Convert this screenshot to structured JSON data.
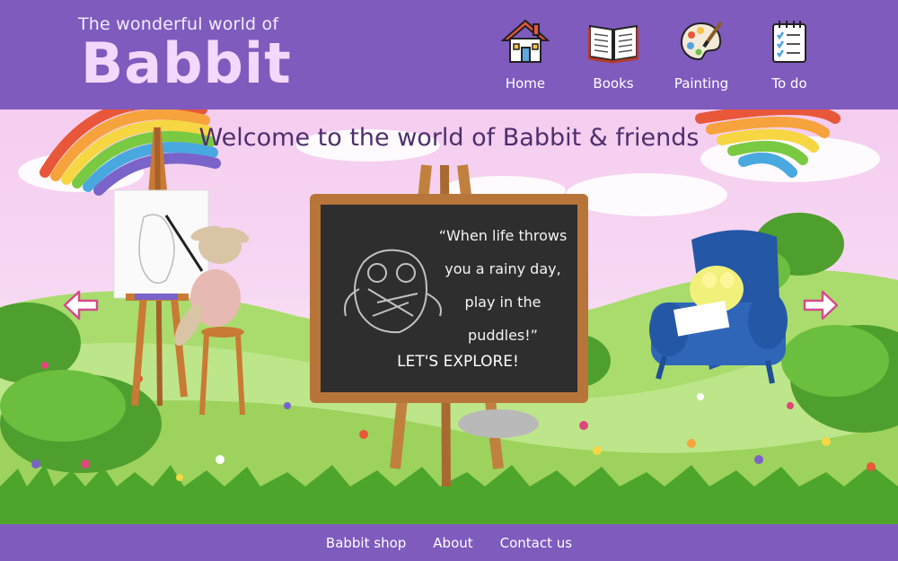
{
  "header": {
    "logo_subtitle": "The wonderful world of",
    "logo_title": "Babbit",
    "nav": [
      {
        "label": "Home",
        "icon": "house-icon"
      },
      {
        "label": "Books",
        "icon": "book-icon"
      },
      {
        "label": "Painting",
        "icon": "palette-icon"
      },
      {
        "label": "To do",
        "icon": "checklist-icon"
      }
    ]
  },
  "hero": {
    "title": "Welcome to the world of Babbit & friends",
    "quote": "“When life throws you a rainy day, play in the puddles!”",
    "cta": "LET'S EXPLORE!",
    "prev_icon": "arrow-left-icon",
    "next_icon": "arrow-right-icon"
  },
  "footer": {
    "links": [
      "Babbit shop",
      "About",
      "Contact us"
    ]
  },
  "colors": {
    "brand_purple": "#7f5bbd",
    "title_purple": "#4d2f6d",
    "chalkboard": "#2e2e2e",
    "wood": "#b8753a"
  }
}
